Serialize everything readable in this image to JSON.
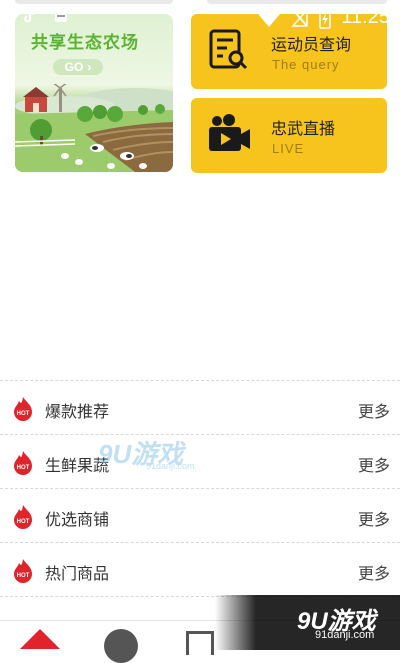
{
  "status_bar": {
    "time": "11:25",
    "icons": [
      "tiktok-icon",
      "app-notification-icon",
      "wifi-icon",
      "no-signal-icon",
      "battery-icon"
    ]
  },
  "banner": {
    "title": "共享生态农场",
    "go_label": "GO"
  },
  "cards": [
    {
      "title": "运动员查询",
      "subtitle": "The query",
      "icon": "search-document-icon"
    },
    {
      "title": "忠武直播",
      "subtitle": "LIVE",
      "icon": "video-camera-icon"
    }
  ],
  "sections": [
    {
      "label": "爆款推荐",
      "more": "更多"
    },
    {
      "label": "生鲜果蔬",
      "more": "更多"
    },
    {
      "label": "优选商铺",
      "more": "更多"
    },
    {
      "label": "热门商品",
      "more": "更多"
    }
  ],
  "watermark": {
    "main": "9U游戏",
    "sub": "91danji.com"
  },
  "corner_watermark": {
    "main": "9U游戏",
    "sub": "91danji.com"
  },
  "colors": {
    "accent_yellow": "#f6c41c",
    "hot_red": "#e0242b",
    "farm_green": "#5bb431"
  }
}
